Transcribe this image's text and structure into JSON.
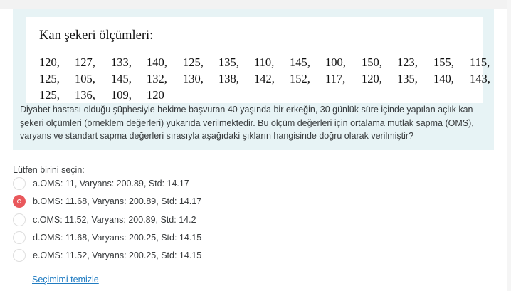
{
  "question": {
    "image_title": "Kan şekeri ölçümleri:",
    "values_rows": [
      [
        "120,",
        "127,",
        "133,",
        "140,",
        "125,",
        "135,",
        "110,",
        "145,",
        "100,",
        "150,",
        "123,",
        "155,",
        "115,"
      ],
      [
        "125,",
        "105,",
        "145,",
        "132,",
        "130,",
        "138,",
        "142,",
        "152,",
        "117,",
        "120,",
        "135,",
        "140,",
        "143,"
      ],
      [
        "125,",
        "136,",
        "109,",
        "120"
      ]
    ],
    "text_lines": [
      "Diyabet hastası olduğu şüphesiyle hekime başvuran 40 yaşında bir erkeğin, 30 günlük süre içinde yapılan açlık kan",
      "şekeri ölçümleri (örneklem değerleri) yukarıda verilmektedir. Bu ölçüm değerleri için ortalama mutlak sapma (OMS),",
      "varyans ve standart sapma değerleri sırasıyla aşağıdaki şıkların hangisinde  doğru olarak verilmiştir?"
    ]
  },
  "answer": {
    "prompt": "Lütfen birini seçin:",
    "options": [
      {
        "label": "a.OMS: 11, Varyans: 200.89, Std: 14.17",
        "selected": false
      },
      {
        "label": "b.OMS: 11.68, Varyans: 200.89, Std: 14.17",
        "selected": true
      },
      {
        "label": "c.OMS: 11.52, Varyans: 200.89, Std: 14.2",
        "selected": false
      },
      {
        "label": "d.OMS: 11.68, Varyans: 200.25, Std: 14.15",
        "selected": false
      },
      {
        "label": "e.OMS: 11.52, Varyans: 200.25, Std: 14.15",
        "selected": false
      }
    ],
    "clear_choice": "Seçimimi temizle"
  },
  "colors": {
    "question_background": "#e7f3f5",
    "selected_radio": "#e9585c",
    "link": "#1f7bc1"
  }
}
